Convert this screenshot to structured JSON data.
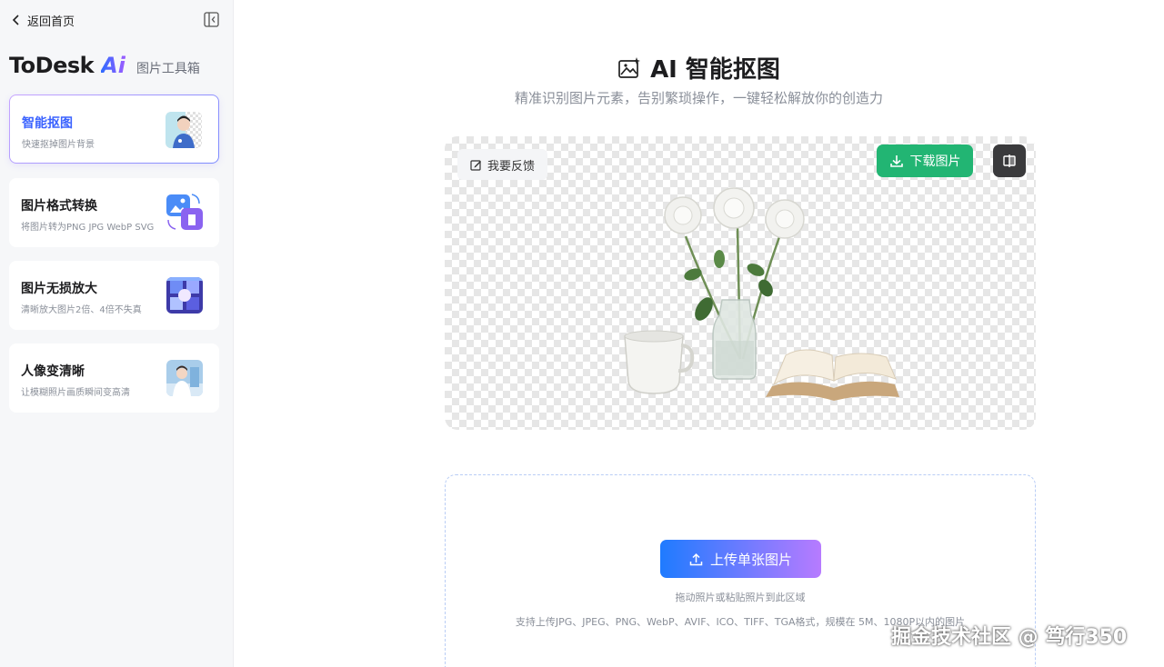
{
  "sidebar": {
    "back_label": "返回首页",
    "brand_name": "ToDesk",
    "brand_ai": "Ai",
    "brand_sub": "图片工具箱",
    "tools": [
      {
        "title": "智能抠图",
        "desc": "快速抠掉图片背景"
      },
      {
        "title": "图片格式转换",
        "desc": "将图片转为PNG JPG WebP SVG"
      },
      {
        "title": "图片无损放大",
        "desc": "清晰放大图片2倍、4倍不失真"
      },
      {
        "title": "人像变清晰",
        "desc": "让模糊照片画质瞬间变高清"
      }
    ]
  },
  "main": {
    "title": "AI 智能抠图",
    "subtitle": "精准识别图片元素，告别繁琐操作，一键轻松解放你的创造力",
    "feedback_label": "我要反馈",
    "download_label": "下载图片",
    "upload_label": "上传单张图片",
    "drag_hint": "拖动照片或粘贴照片到此区域",
    "format_hint": "支持上传JPG、JPEG、PNG、WebP、AVIF、ICO、TIFF、TGA格式，规模在 5M、1080P以内的图片"
  },
  "watermark": "掘金技术社区 @ 笃行350",
  "colors": {
    "accent": "#3b63ff",
    "download": "#22b573",
    "dark_btn": "#3a3a3c"
  },
  "icons": [
    "chevron-left-icon",
    "sidebar-collapse-icon",
    "image-sparkle-icon",
    "edit-icon",
    "download-icon",
    "compare-icon",
    "upload-icon"
  ]
}
